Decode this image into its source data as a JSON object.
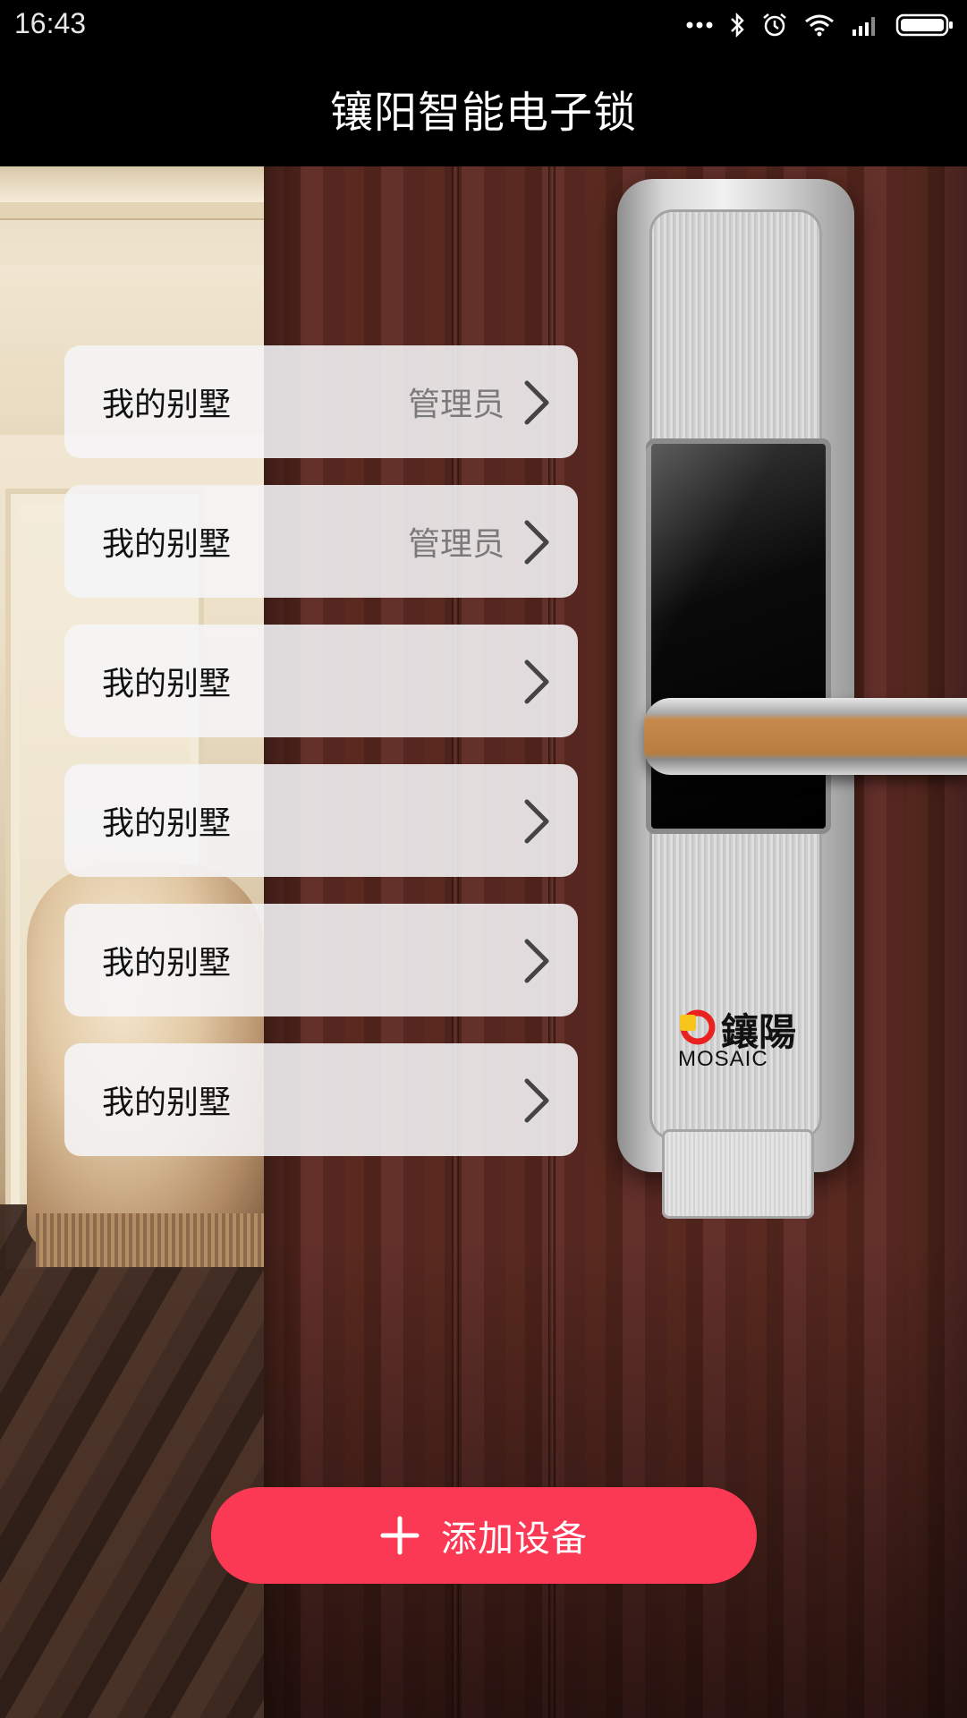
{
  "status_bar": {
    "time": "16:43",
    "icons": [
      "more-dots-icon",
      "bluetooth-icon",
      "alarm-icon",
      "wifi-icon",
      "signal-icon",
      "battery-icon"
    ]
  },
  "header": {
    "title": "镶阳智能电子锁"
  },
  "devices": [
    {
      "name": "我的别墅",
      "role": "管理员"
    },
    {
      "name": "我的别墅",
      "role": "管理员"
    },
    {
      "name": "我的别墅",
      "role": ""
    },
    {
      "name": "我的别墅",
      "role": ""
    },
    {
      "name": "我的别墅",
      "role": ""
    },
    {
      "name": "我的别墅",
      "role": ""
    }
  ],
  "lock_brand": {
    "cn": "鑲陽",
    "en": "MOSAIC"
  },
  "add_button": {
    "label": "添加设备",
    "icon": "plus-icon"
  },
  "colors": {
    "accent": "#fc3955",
    "header_bg": "#000000",
    "card_bg": "#f5f5f7"
  }
}
